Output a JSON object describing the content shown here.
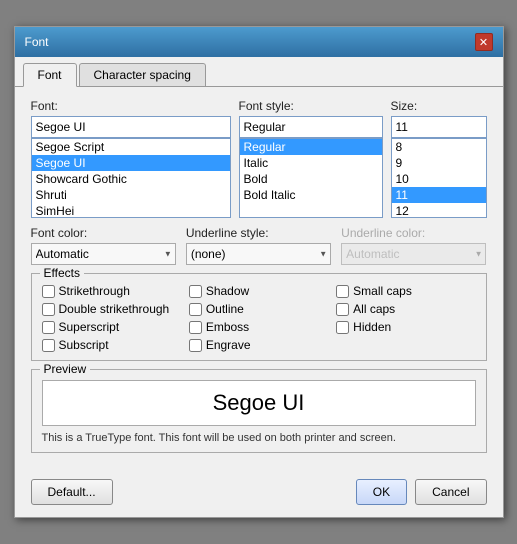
{
  "dialog": {
    "title": "Font",
    "close_button": "✕"
  },
  "tabs": [
    {
      "id": "font",
      "label": "Font",
      "active": true
    },
    {
      "id": "character-spacing",
      "label": "Character spacing",
      "active": false
    }
  ],
  "font_tab": {
    "font_label": "Font:",
    "font_value": "Segoe UI",
    "font_list": [
      {
        "label": "Segoe Script",
        "selected": false
      },
      {
        "label": "Segoe UI",
        "selected": true
      },
      {
        "label": "Showcard Gothic",
        "selected": false
      },
      {
        "label": "Shruti",
        "selected": false
      },
      {
        "label": "SimHei",
        "selected": false
      }
    ],
    "style_label": "Font style:",
    "style_value": "Regular",
    "style_list": [
      {
        "label": "Regular",
        "selected": true
      },
      {
        "label": "Italic",
        "selected": false
      },
      {
        "label": "Bold",
        "selected": false
      },
      {
        "label": "Bold Italic",
        "selected": false
      }
    ],
    "size_label": "Size:",
    "size_value": "11",
    "size_list": [
      {
        "label": "8",
        "selected": false
      },
      {
        "label": "9",
        "selected": false
      },
      {
        "label": "10",
        "selected": false
      },
      {
        "label": "11",
        "selected": true
      },
      {
        "label": "12",
        "selected": false
      }
    ],
    "font_color_label": "Font color:",
    "font_color_value": "Automatic",
    "underline_style_label": "Underline style:",
    "underline_style_value": "(none)",
    "underline_color_label": "Underline color:",
    "underline_color_value": "Automatic",
    "effects_label": "Effects",
    "effects": [
      {
        "id": "strikethrough",
        "label": "Strikethrough",
        "checked": false
      },
      {
        "id": "shadow",
        "label": "Shadow",
        "checked": false
      },
      {
        "id": "small-caps",
        "label": "Small caps",
        "checked": false
      },
      {
        "id": "double-strikethrough",
        "label": "Double strikethrough",
        "checked": false
      },
      {
        "id": "outline",
        "label": "Outline",
        "checked": false
      },
      {
        "id": "all-caps",
        "label": "All caps",
        "checked": false
      },
      {
        "id": "superscript",
        "label": "Superscript",
        "checked": false
      },
      {
        "id": "emboss",
        "label": "Emboss",
        "checked": false
      },
      {
        "id": "hidden",
        "label": "Hidden",
        "checked": false
      },
      {
        "id": "subscript",
        "label": "Subscript",
        "checked": false
      },
      {
        "id": "engrave",
        "label": "Engrave",
        "checked": false
      }
    ],
    "preview_label": "Preview",
    "preview_text": "Segoe UI",
    "preview_note": "This is a TrueType font. This font will be used on both printer and screen.",
    "default_button": "Default...",
    "ok_button": "OK",
    "cancel_button": "Cancel"
  }
}
